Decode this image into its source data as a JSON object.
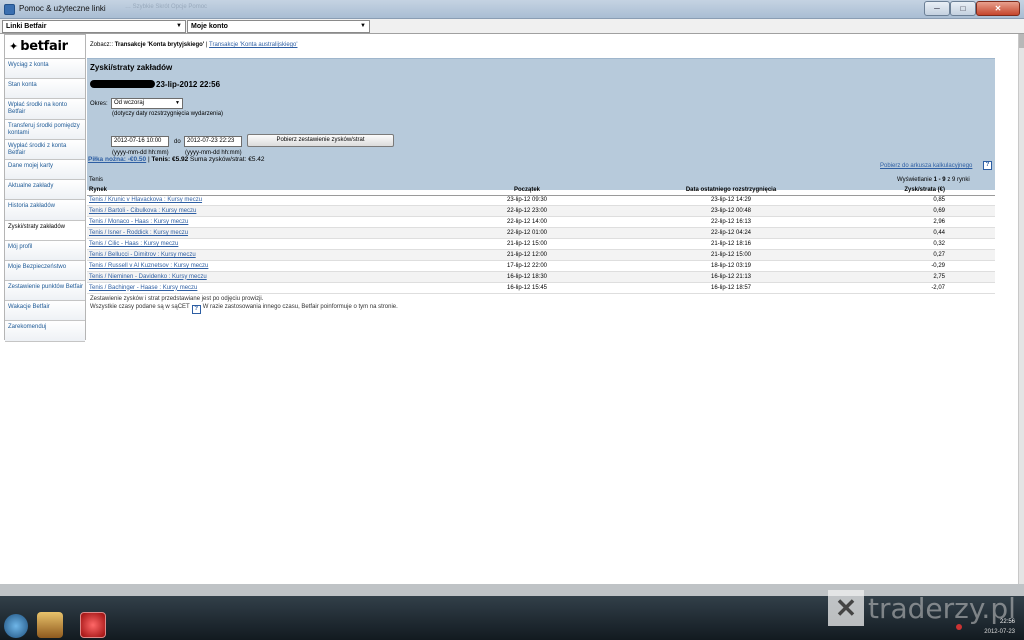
{
  "window": {
    "title": "Pomoc & użyteczne linki",
    "ghost_title": "…  Szybkie  Skrót  Opcje  Pomoc",
    "min": "─",
    "max": "□",
    "close": "✕"
  },
  "dropdowns": {
    "links": "Linki Betfair",
    "account": "Moje konto",
    "arrow": "▼"
  },
  "logo": {
    "star": "✦",
    "text": "betfair"
  },
  "sidebar": {
    "items": [
      {
        "label": "Wyciąg z konta"
      },
      {
        "label": "Stan konta"
      },
      {
        "label": "Wpłać środki na konto Betfair"
      },
      {
        "label": "Transferuj środki pomiędzy kontami"
      },
      {
        "label": "Wypłać środki z konta Betfair"
      },
      {
        "label": "Dane mojej karty"
      },
      {
        "label": "Aktualne zakłady"
      },
      {
        "label": "Historia zakładów"
      },
      {
        "label": "Zyski/straty zakładów"
      },
      {
        "label": "Mój profil"
      },
      {
        "label": "Moje Bezpieczeństwo"
      },
      {
        "label": "Zestawienie punktów Betfair"
      },
      {
        "label": "Wakacje Betfair"
      },
      {
        "label": "Zarekomenduj"
      }
    ]
  },
  "seeline": {
    "label": "Zobacz::",
    "current": "Transakcje 'Konta brytyjskiego'",
    "separator": "|",
    "other_link": "Transakcje 'Konta australijskiego'"
  },
  "panel": {
    "heading": "Zyski/straty zakładów",
    "datetime": "23-lip-2012 22:56",
    "period_label": "Okres:",
    "period_value": "Od wczoraj",
    "period_note": "(dotyczy daty rozstrzygnięcia wydarzenia)",
    "date_from": "2012-07-16 10:00",
    "to_label": "do",
    "date_to": "2012-07-23 22:23",
    "format_hint": "(yyyy-mm-dd hh:mm)",
    "fetch_button": "Pobierz zestawienie zysków/strat",
    "xls_link": "Pobierz do arkusza kalkulacyjnego",
    "help": "?"
  },
  "summary": {
    "football_link": "Piłka nożna: -€0.50",
    "sep": "|",
    "tennis": "Tenis: €5.92",
    "total_label": "Suma zysków/strat:",
    "total_value": "€5.42"
  },
  "results": {
    "sport": "Tenis",
    "showing_prefix": "Wyświetlanie",
    "showing_range": "1 - 9",
    "showing_suffix": "z 9 rynki",
    "columns": {
      "market": "Rynek",
      "start": "Początek",
      "settled": "Data ostatniego rozstrzygnięcia",
      "pl": "Zysk/strata (€)"
    },
    "rows": [
      {
        "market": "Tenis / Krunic v Hlavackova : Kursy meczu",
        "start": "23-lip-12 09:30",
        "settled": "23-lip-12 14:29",
        "pl": "0,85"
      },
      {
        "market": "Tenis / Bartoli - Cibulkova : Kursy meczu",
        "start": "22-lip-12 23:00",
        "settled": "23-lip-12 00:48",
        "pl": "0,69"
      },
      {
        "market": "Tenis / Monaco - Haas : Kursy meczu",
        "start": "22-lip-12 14:00",
        "settled": "22-lip-12 16:13",
        "pl": "2,96"
      },
      {
        "market": "Tenis / Isner - Roddick : Kursy meczu",
        "start": "22-lip-12 01:00",
        "settled": "22-lip-12 04:24",
        "pl": "0,44"
      },
      {
        "market": "Tenis / Cilic - Haas : Kursy meczu",
        "start": "21-lip-12 15:00",
        "settled": "21-lip-12 18:16",
        "pl": "0,32"
      },
      {
        "market": "Tenis / Bellucci - Dimitrov : Kursy meczu",
        "start": "21-lip-12 12:00",
        "settled": "21-lip-12 15:00",
        "pl": "0,27"
      },
      {
        "market": "Tenis / Russell v Al Kuznetsov : Kursy meczu",
        "start": "17-lip-12 22:00",
        "settled": "18-lip-12 03:19",
        "pl": "-0,29"
      },
      {
        "market": "Tenis / Nieminen - Davidenko : Kursy meczu",
        "start": "16-lip-12 18:30",
        "settled": "16-lip-12 21:13",
        "pl": "2,75"
      },
      {
        "market": "Tenis / Bachinger - Haase : Kursy meczu",
        "start": "16-lip-12 15:45",
        "settled": "16-lip-12 18:57",
        "pl": "-2,07"
      }
    ]
  },
  "footnotes": {
    "line1": "Zestawienie zysków i strat przedstawiane jest po odjęciu prowizji.",
    "line2_a": "Wszystkie czasy podane są w sąCET",
    "line2_b": "W razie zastosowania innego czasu, Betfair poinformuje o tym na stronie."
  },
  "taskbar": {
    "watermark": "traderzy.pl",
    "watermark_glyph": "✕",
    "time": "22:56",
    "date": "2012-07-23"
  }
}
